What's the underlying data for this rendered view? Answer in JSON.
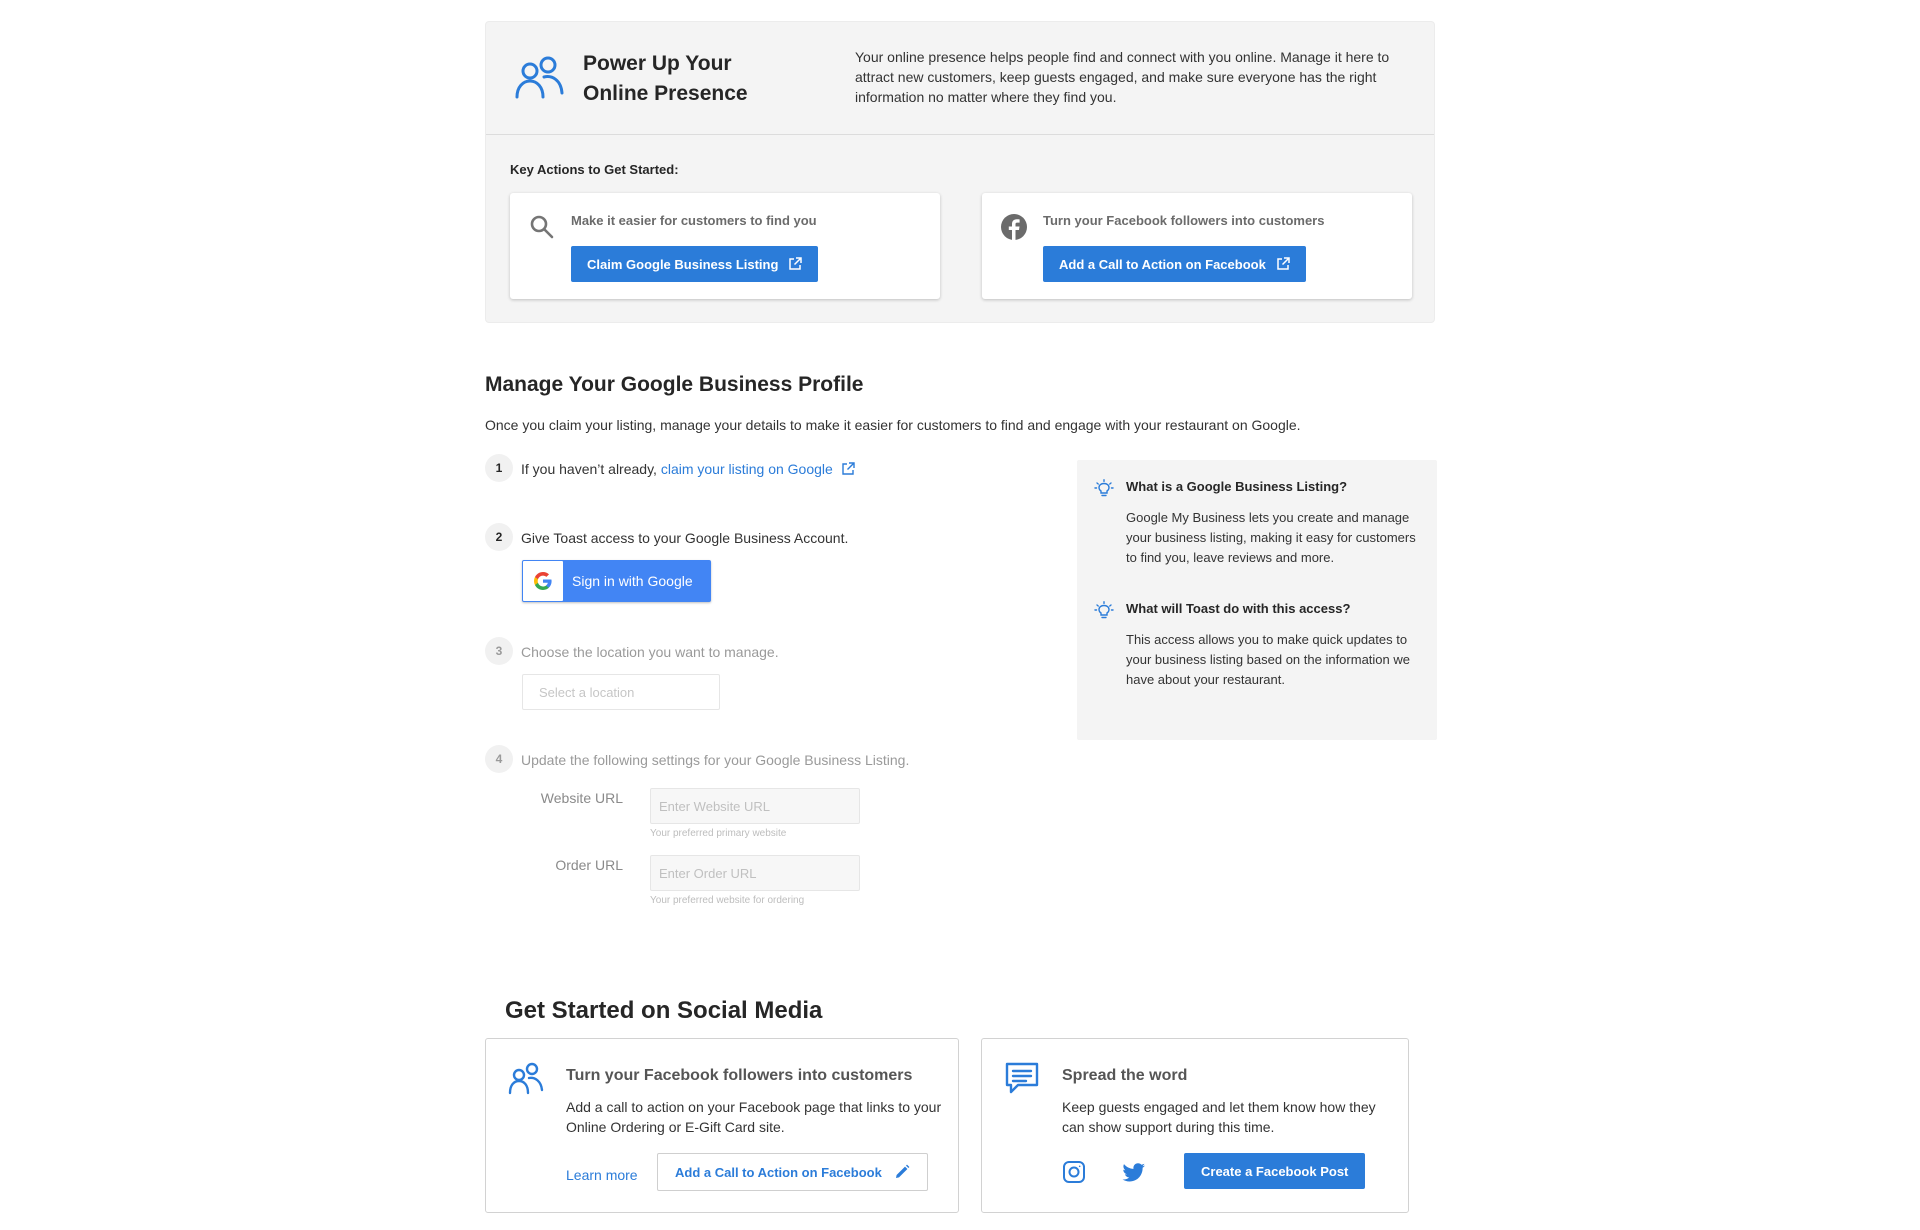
{
  "hero": {
    "title": "Power Up Your Online Presence",
    "description": "Your online presence helps people find and connect with you online. Manage it here to attract new customers, keep guests engaged, and make sure everyone has the right information no matter where they find you.",
    "key_actions_label": "Key Actions to Get Started:",
    "cards": [
      {
        "text": "Make it easier for customers to find you",
        "button": "Claim Google Business Listing"
      },
      {
        "text": "Turn your Facebook followers into customers",
        "button": "Add a Call to Action on Facebook"
      }
    ]
  },
  "google": {
    "title": "Manage Your Google Business Profile",
    "description": "Once you claim your listing, manage your details to make it easier for customers to find and engage with your restaurant on Google.",
    "steps": [
      {
        "num": "1",
        "text": "If you haven’t already,",
        "link": "claim your listing on Google"
      },
      {
        "num": "2",
        "text": "Give Toast access to your Google Business Account.",
        "button": "Sign in with Google"
      },
      {
        "num": "3",
        "text": "Choose the location you want to manage.",
        "select_placeholder": "Select a location"
      },
      {
        "num": "4",
        "text": "Update the following settings for your Google Business Listing."
      }
    ],
    "fields": [
      {
        "label": "Website URL",
        "placeholder": "Enter Website URL",
        "help": "Your preferred primary website"
      },
      {
        "label": "Order URL",
        "placeholder": "Enter Order URL",
        "help": "Your preferred website for ordering"
      }
    ],
    "info": [
      {
        "q": "What is a Google Business Listing?",
        "a": "Google My Business lets you create and manage your business listing, making it easy for customers to find you, leave reviews and more."
      },
      {
        "q": "What will Toast do with this access?",
        "a": "This access allows you to make quick updates to your business listing based on the information we have about your restaurant."
      }
    ]
  },
  "social": {
    "title": "Get Started on Social Media",
    "cards": [
      {
        "title": "Turn your Facebook followers into customers",
        "desc": "Add a call to action on your Facebook page that links to your Online Ordering or E-Gift Card site.",
        "learn_more": "Learn more",
        "button": "Add a Call to Action on Facebook"
      },
      {
        "title": "Spread the word",
        "desc": "Keep guests engaged and let them know how they can show support during this time.",
        "button": "Create a Facebook Post"
      }
    ]
  },
  "colors": {
    "accent": "#2b7cd9",
    "google_blue": "#4285f4",
    "panel": "#f4f4f4"
  }
}
